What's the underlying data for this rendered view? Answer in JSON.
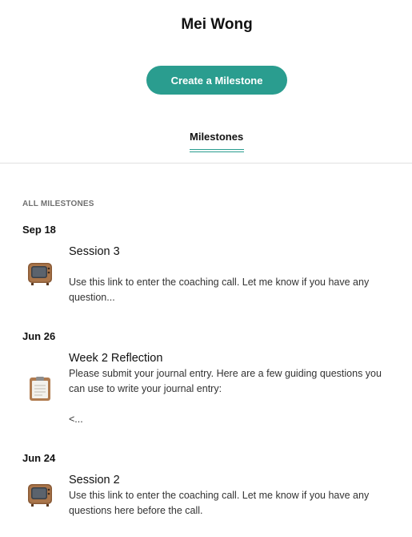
{
  "header": {
    "name": "Mei Wong"
  },
  "actions": {
    "create_label": "Create a Milestone"
  },
  "tabs": [
    {
      "label": "Milestones",
      "active": true
    }
  ],
  "section": {
    "label": "ALL MILESTONES"
  },
  "milestones": [
    {
      "date": "Sep 18",
      "icon": "television-icon",
      "title": "Session 3",
      "description": "Use this link to enter the coaching call. Let me know if you have any question..."
    },
    {
      "date": "Jun 26",
      "icon": "clipboard-icon",
      "title": "Week 2 Reflection",
      "description": "Please submit your journal entry. Here are a few guiding questions you can use to write your journal entry:\n\n<..."
    },
    {
      "date": "Jun 24",
      "icon": "television-icon",
      "title": "Session 2",
      "description": "Use this link to enter the coaching call. Let me know if you have any questions here before the call."
    }
  ],
  "colors": {
    "accent": "#2a9d8f",
    "divider": "#e1e1e1",
    "section_label": "#707070"
  }
}
